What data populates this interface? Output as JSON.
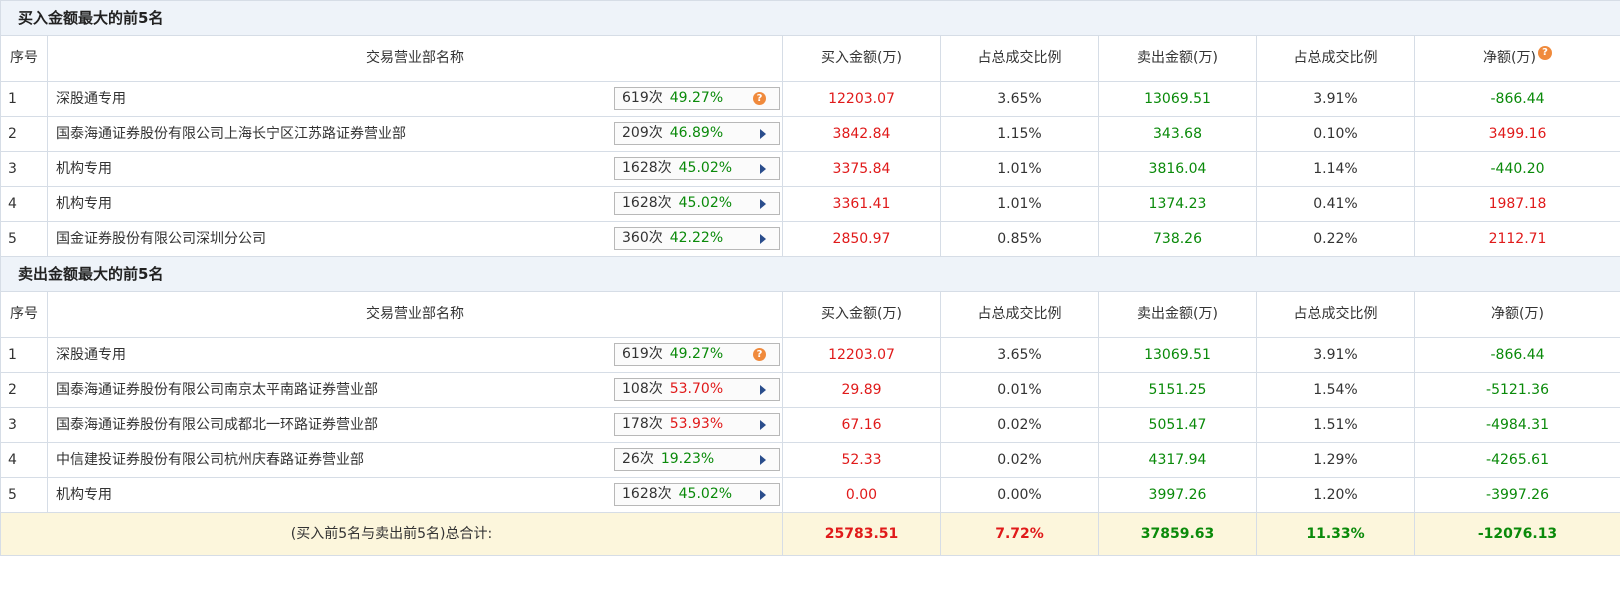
{
  "buy_section": {
    "title": "买入金额最大的前5名",
    "headers": [
      "序号",
      "交易营业部名称",
      "买入金额(万)",
      "占总成交比例",
      "卖出金额(万)",
      "占总成交比例",
      "净额(万)"
    ],
    "net_help_icon": "question-icon",
    "rows": [
      {
        "no": "1",
        "name": "深股通专用",
        "count": "619次",
        "pct": "49.27%",
        "pct_color": "green",
        "icon": "question-icon",
        "buy": "12203.07",
        "buy_ratio": "3.65%",
        "sell": "13069.51",
        "sell_ratio": "3.91%",
        "net": "-866.44",
        "net_color": "green"
      },
      {
        "no": "2",
        "name": "国泰海通证券股份有限公司上海长宁区江苏路证券营业部",
        "count": "209次",
        "pct": "46.89%",
        "pct_color": "green",
        "icon": "play-arrow-icon",
        "buy": "3842.84",
        "buy_ratio": "1.15%",
        "sell": "343.68",
        "sell_ratio": "0.10%",
        "net": "3499.16",
        "net_color": "red"
      },
      {
        "no": "3",
        "name": "机构专用",
        "count": "1628次",
        "pct": "45.02%",
        "pct_color": "green",
        "icon": "play-arrow-icon",
        "buy": "3375.84",
        "buy_ratio": "1.01%",
        "sell": "3816.04",
        "sell_ratio": "1.14%",
        "net": "-440.20",
        "net_color": "green"
      },
      {
        "no": "4",
        "name": "机构专用",
        "count": "1628次",
        "pct": "45.02%",
        "pct_color": "green",
        "icon": "play-arrow-icon",
        "buy": "3361.41",
        "buy_ratio": "1.01%",
        "sell": "1374.23",
        "sell_ratio": "0.41%",
        "net": "1987.18",
        "net_color": "red"
      },
      {
        "no": "5",
        "name": "国金证券股份有限公司深圳分公司",
        "count": "360次",
        "pct": "42.22%",
        "pct_color": "green",
        "icon": "play-arrow-icon",
        "buy": "2850.97",
        "buy_ratio": "0.85%",
        "sell": "738.26",
        "sell_ratio": "0.22%",
        "net": "2112.71",
        "net_color": "red"
      }
    ]
  },
  "sell_section": {
    "title": "卖出金额最大的前5名",
    "headers": [
      "序号",
      "交易营业部名称",
      "买入金额(万)",
      "占总成交比例",
      "卖出金额(万)",
      "占总成交比例",
      "净额(万)"
    ],
    "rows": [
      {
        "no": "1",
        "name": "深股通专用",
        "count": "619次",
        "pct": "49.27%",
        "pct_color": "green",
        "icon": "question-icon",
        "buy": "12203.07",
        "buy_ratio": "3.65%",
        "sell": "13069.51",
        "sell_ratio": "3.91%",
        "net": "-866.44",
        "net_color": "green"
      },
      {
        "no": "2",
        "name": "国泰海通证券股份有限公司南京太平南路证券营业部",
        "count": "108次",
        "pct": "53.70%",
        "pct_color": "red",
        "icon": "play-arrow-icon",
        "buy": "29.89",
        "buy_ratio": "0.01%",
        "sell": "5151.25",
        "sell_ratio": "1.54%",
        "net": "-5121.36",
        "net_color": "green"
      },
      {
        "no": "3",
        "name": "国泰海通证券股份有限公司成都北一环路证券营业部",
        "count": "178次",
        "pct": "53.93%",
        "pct_color": "red",
        "icon": "play-arrow-icon",
        "buy": "67.16",
        "buy_ratio": "0.02%",
        "sell": "5051.47",
        "sell_ratio": "1.51%",
        "net": "-4984.31",
        "net_color": "green"
      },
      {
        "no": "4",
        "name": "中信建投证券股份有限公司杭州庆春路证券营业部",
        "count": "26次",
        "pct": "19.23%",
        "pct_color": "green",
        "icon": "play-arrow-icon",
        "buy": "52.33",
        "buy_ratio": "0.02%",
        "sell": "4317.94",
        "sell_ratio": "1.29%",
        "net": "-4265.61",
        "net_color": "green"
      },
      {
        "no": "5",
        "name": "机构专用",
        "count": "1628次",
        "pct": "45.02%",
        "pct_color": "green",
        "icon": "play-arrow-icon",
        "buy": "0.00",
        "buy_ratio": "0.00%",
        "sell": "3997.26",
        "sell_ratio": "1.20%",
        "net": "-3997.26",
        "net_color": "green"
      }
    ]
  },
  "total": {
    "label": "(买入前5名与卖出前5名)总合计:",
    "buy": "25783.51",
    "buy_ratio": "7.72%",
    "sell": "37859.63",
    "sell_ratio": "11.33%",
    "net": "-12076.13"
  },
  "colors": {
    "red": "#e01a1a",
    "green": "#0a8a0a",
    "header_bg": "#eef3f9",
    "total_bg": "#fcf6dc",
    "icon_orange": "#f08a3c"
  }
}
